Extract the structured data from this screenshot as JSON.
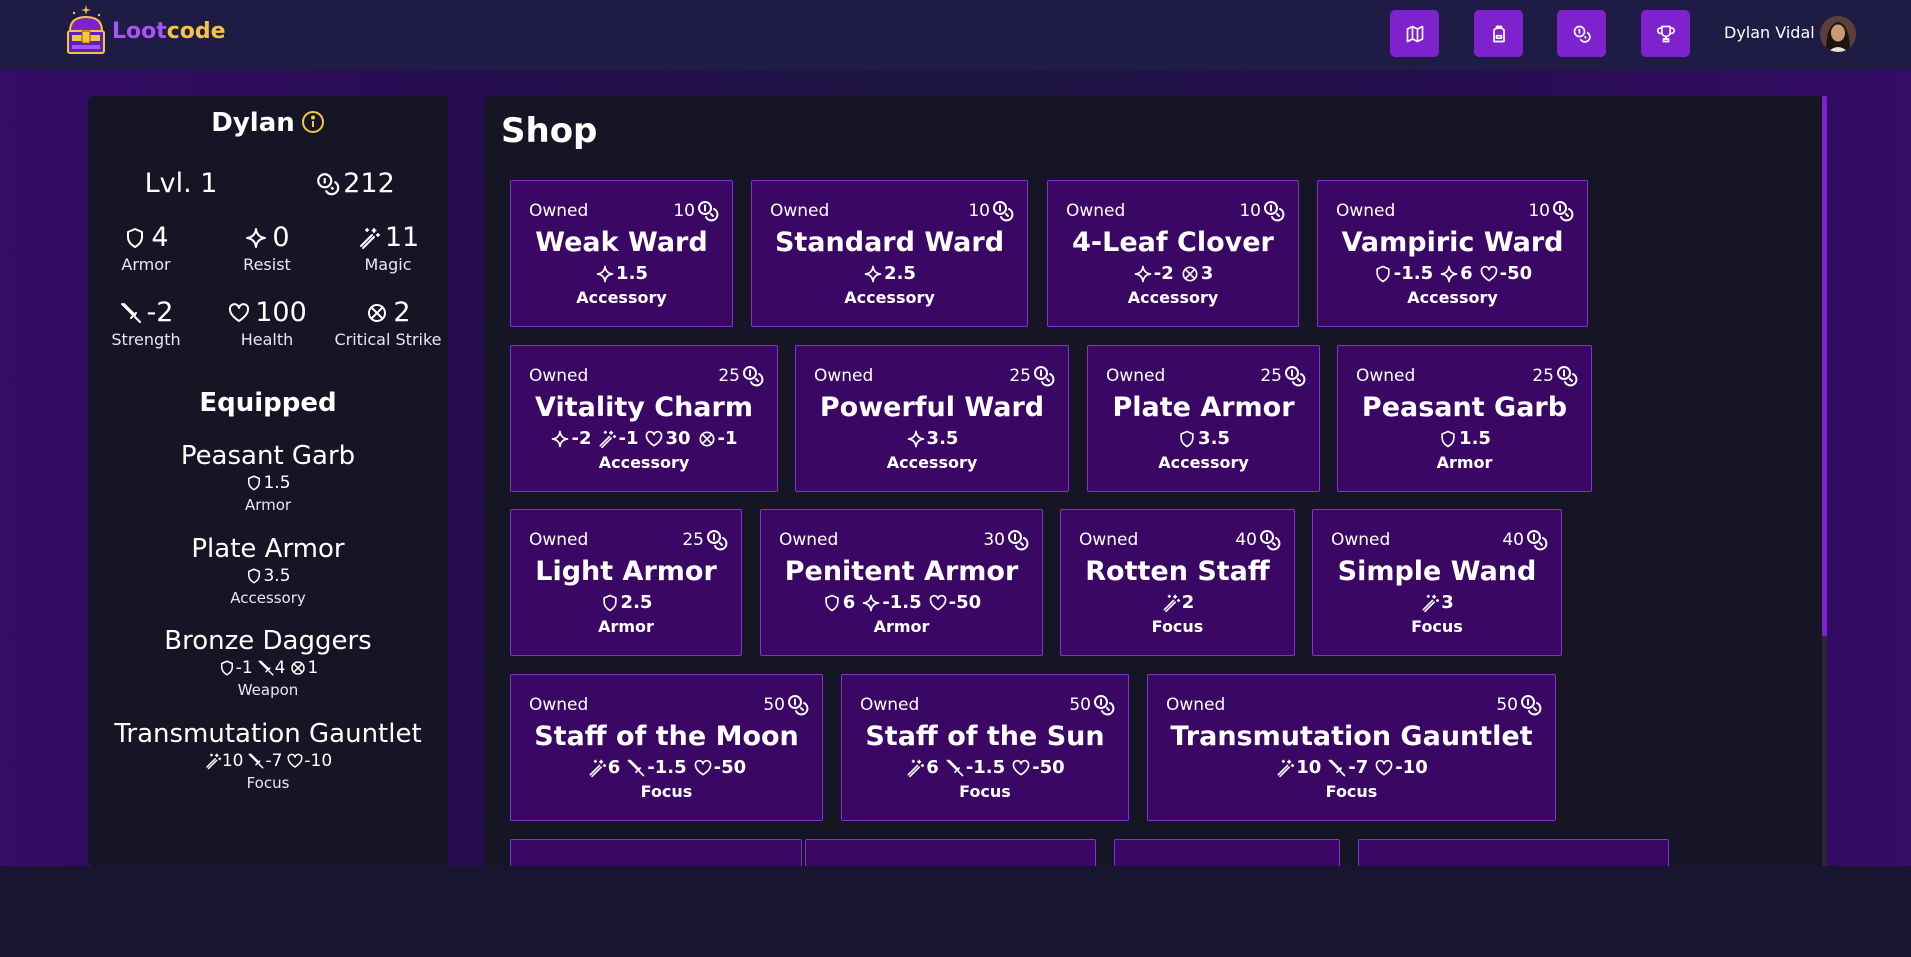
{
  "brand": {
    "part1": "Loot",
    "part2": "code"
  },
  "nav": [
    {
      "name": "map-icon"
    },
    {
      "name": "backpack-icon"
    },
    {
      "name": "coins-icon"
    },
    {
      "name": "trophy-icon"
    }
  ],
  "user": {
    "name": "Dylan Vidal"
  },
  "character": {
    "name": "Dylan",
    "level": "Lvl. 1",
    "gold": "212",
    "stats": [
      {
        "icon": "shield",
        "value": "4",
        "label": "Armor"
      },
      {
        "icon": "sparkle",
        "value": "0",
        "label": "Resist"
      },
      {
        "icon": "wand",
        "value": "11",
        "label": "Magic"
      },
      {
        "icon": "sword",
        "value": "-2",
        "label": "Strength"
      },
      {
        "icon": "heart",
        "value": "100",
        "label": "Health"
      },
      {
        "icon": "crit",
        "value": "2",
        "label": "Critical Strike"
      }
    ]
  },
  "equipped": {
    "title": "Equipped",
    "items": [
      {
        "name": "Peasant Garb",
        "type": "Armor",
        "stats": [
          {
            "icon": "shield",
            "value": "1.5"
          }
        ]
      },
      {
        "name": "Plate Armor",
        "type": "Accessory",
        "stats": [
          {
            "icon": "shield",
            "value": "3.5"
          }
        ]
      },
      {
        "name": "Bronze Daggers",
        "type": "Weapon",
        "stats": [
          {
            "icon": "shield",
            "value": "-1"
          },
          {
            "icon": "sword",
            "value": "4"
          },
          {
            "icon": "crit",
            "value": "1"
          }
        ]
      },
      {
        "name": "Transmutation Gauntlet",
        "type": "Focus",
        "stats": [
          {
            "icon": "wand",
            "value": "10"
          },
          {
            "icon": "sword",
            "value": "-7"
          },
          {
            "icon": "heart",
            "value": "-10"
          }
        ]
      }
    ]
  },
  "shop": {
    "title": "Shop",
    "owned_label": "Owned",
    "items": [
      {
        "name": "Weak Ward",
        "price": "10",
        "type": "Accessory",
        "stats": [
          {
            "icon": "sparkle",
            "value": "1.5"
          }
        ]
      },
      {
        "name": "Standard Ward",
        "price": "10",
        "type": "Accessory",
        "stats": [
          {
            "icon": "sparkle",
            "value": "2.5"
          }
        ]
      },
      {
        "name": "4-Leaf Clover",
        "price": "10",
        "type": "Accessory",
        "stats": [
          {
            "icon": "sparkle",
            "value": "-2"
          },
          {
            "icon": "crit",
            "value": "3"
          }
        ]
      },
      {
        "name": "Vampiric Ward",
        "price": "10",
        "type": "Accessory",
        "stats": [
          {
            "icon": "shield",
            "value": "-1.5"
          },
          {
            "icon": "sparkle",
            "value": "6"
          },
          {
            "icon": "heart",
            "value": "-50"
          }
        ]
      },
      {
        "name": "Vitality Charm",
        "price": "25",
        "type": "Accessory",
        "stats": [
          {
            "icon": "sparkle",
            "value": "-2"
          },
          {
            "icon": "wand",
            "value": "-1"
          },
          {
            "icon": "heart",
            "value": "30"
          },
          {
            "icon": "crit",
            "value": "-1"
          }
        ]
      },
      {
        "name": "Powerful Ward",
        "price": "25",
        "type": "Accessory",
        "stats": [
          {
            "icon": "sparkle",
            "value": "3.5"
          }
        ]
      },
      {
        "name": "Plate Armor",
        "price": "25",
        "type": "Accessory",
        "stats": [
          {
            "icon": "shield",
            "value": "3.5"
          }
        ]
      },
      {
        "name": "Peasant Garb",
        "price": "25",
        "type": "Armor",
        "stats": [
          {
            "icon": "shield",
            "value": "1.5"
          }
        ]
      },
      {
        "name": "Light Armor",
        "price": "25",
        "type": "Armor",
        "stats": [
          {
            "icon": "shield",
            "value": "2.5"
          }
        ]
      },
      {
        "name": "Penitent Armor",
        "price": "30",
        "type": "Armor",
        "stats": [
          {
            "icon": "shield",
            "value": "6"
          },
          {
            "icon": "sparkle",
            "value": "-1.5"
          },
          {
            "icon": "heart",
            "value": "-50"
          }
        ]
      },
      {
        "name": "Rotten Staff",
        "price": "40",
        "type": "Focus",
        "stats": [
          {
            "icon": "wand",
            "value": "2"
          }
        ]
      },
      {
        "name": "Simple Wand",
        "price": "40",
        "type": "Focus",
        "stats": [
          {
            "icon": "wand",
            "value": "3"
          }
        ]
      },
      {
        "name": "Staff of the Moon",
        "price": "50",
        "type": "Focus",
        "stats": [
          {
            "icon": "wand",
            "value": "6"
          },
          {
            "icon": "sword",
            "value": "-1.5"
          },
          {
            "icon": "heart",
            "value": "-50"
          }
        ]
      },
      {
        "name": "Staff of the Sun",
        "price": "50",
        "type": "Focus",
        "stats": [
          {
            "icon": "wand",
            "value": "6"
          },
          {
            "icon": "sword",
            "value": "-1.5"
          },
          {
            "icon": "heart",
            "value": "-50"
          }
        ]
      },
      {
        "name": "Transmutation Gauntlet",
        "price": "50",
        "type": "Focus",
        "stats": [
          {
            "icon": "wand",
            "value": "10"
          },
          {
            "icon": "sword",
            "value": "-7"
          },
          {
            "icon": "heart",
            "value": "-10"
          }
        ]
      }
    ]
  },
  "colors": {
    "accent": "#7e22ce",
    "card": "#3b0764",
    "panel": "#161525",
    "brand_purple": "#a855f7",
    "brand_gold": "#f5c542"
  }
}
